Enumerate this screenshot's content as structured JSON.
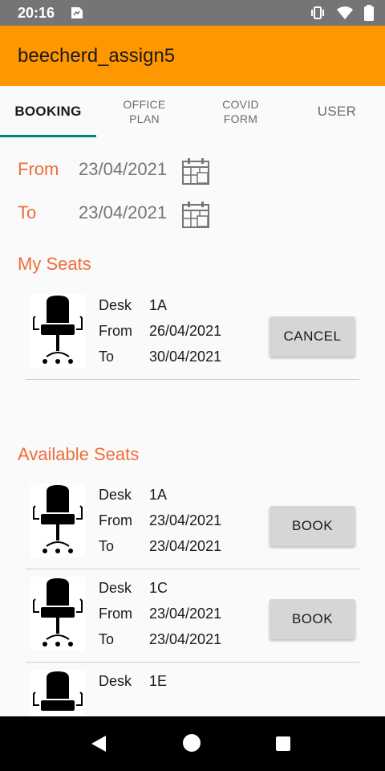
{
  "status": {
    "time": "20:16"
  },
  "app": {
    "title": "beecherd_assign5"
  },
  "tabs": [
    {
      "label": "BOOKING"
    },
    {
      "label": "OFFICE\nPLAN"
    },
    {
      "label": "COVID\nFORM"
    },
    {
      "label": "USER"
    }
  ],
  "filter": {
    "from_label": "From",
    "from_value": "23/04/2021",
    "to_label": "To",
    "to_value": "23/04/2021"
  },
  "my_seats": {
    "heading": "My Seats",
    "items": [
      {
        "desk_label": "Desk",
        "desk": "1A",
        "from_label": "From",
        "from": "26/04/2021",
        "to_label": "To",
        "to": "30/04/2021",
        "action": "CANCEL"
      }
    ]
  },
  "available_seats": {
    "heading": "Available Seats",
    "items": [
      {
        "desk_label": "Desk",
        "desk": "1A",
        "from_label": "From",
        "from": "23/04/2021",
        "to_label": "To",
        "to": "23/04/2021",
        "action": "BOOK"
      },
      {
        "desk_label": "Desk",
        "desk": "1C",
        "from_label": "From",
        "from": "23/04/2021",
        "to_label": "To",
        "to": "23/04/2021",
        "action": "BOOK"
      },
      {
        "desk_label": "Desk",
        "desk": "1E"
      }
    ]
  }
}
